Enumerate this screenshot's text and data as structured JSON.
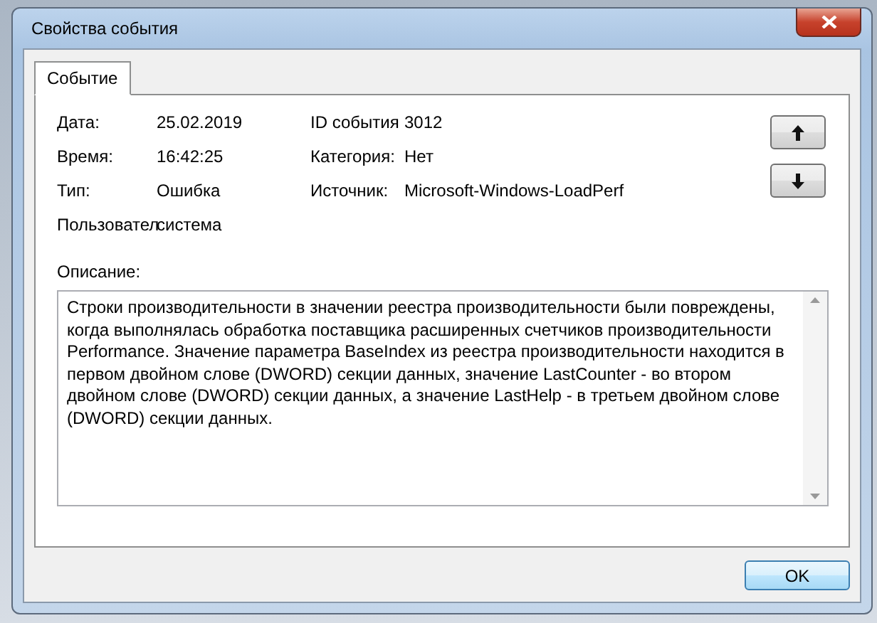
{
  "window": {
    "title": "Свойства события"
  },
  "tabs": [
    {
      "label": "Событие",
      "selected": true
    }
  ],
  "fields_left": [
    {
      "label": "Дата:",
      "value": "25.02.2019"
    },
    {
      "label": "Время:",
      "value": "16:42:25"
    },
    {
      "label": "Тип:",
      "value": "Ошибка"
    },
    {
      "label": "Пользовател",
      "value": "система"
    }
  ],
  "fields_right": [
    {
      "label": "ID события",
      "value": "3012"
    },
    {
      "label": "Категория:",
      "value": "Нет"
    },
    {
      "label": "Источник:",
      "value": "Microsoft-Windows-LoadPerf"
    }
  ],
  "nav_buttons": [
    {
      "kind": "up"
    },
    {
      "kind": "down"
    }
  ],
  "description": {
    "label": "Описание:",
    "text": "Строки производительности в значении реестра производительности были повреждены, когда выполнялась обработка поставщика расширенных счетчиков производительности Performance. Значение параметра BaseIndex из реестра производительности находится в первом двойном слове (DWORD) секции данных, значение LastCounter - во втором двойном слове (DWORD) секции данных, а значение LastHelp - в третьем двойном слове (DWORD) секции данных."
  },
  "buttons": [
    "OK"
  ]
}
